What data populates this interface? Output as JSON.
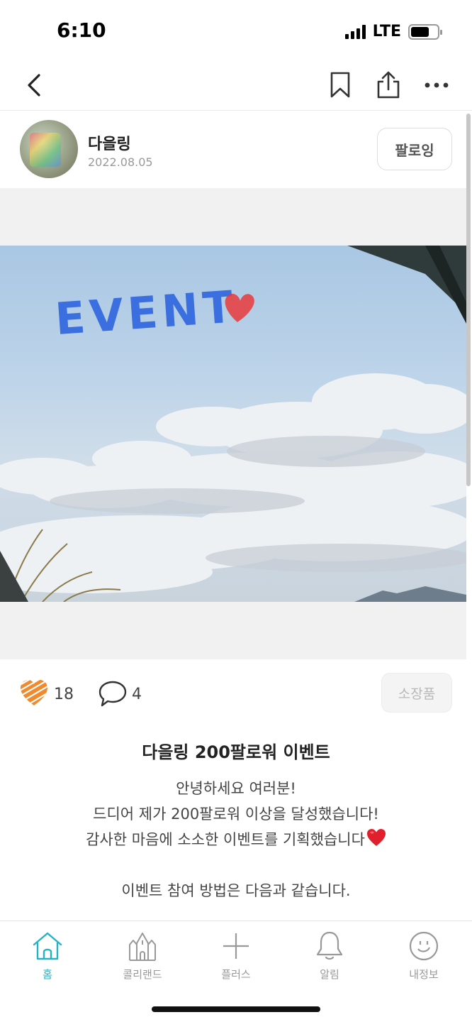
{
  "status_bar": {
    "time": "6:10",
    "network": "LTE",
    "battery_level": 0.7
  },
  "top_nav": {
    "icons": [
      "back-icon",
      "bookmark-icon",
      "share-icon",
      "more-icon"
    ]
  },
  "author": {
    "name": "다을링",
    "date": "2022.08.05",
    "follow_label": "팔로잉"
  },
  "photo": {
    "overlay_text": "EVENT",
    "overlay_color": "#3b6fe0",
    "heart_color": "#e83a3a"
  },
  "actions": {
    "like_count": "18",
    "comment_count": "4",
    "collect_label": "소장품",
    "like_color": "#f08a2c"
  },
  "post": {
    "title": "다을링 200팔로워 이벤트",
    "lines": [
      "안녕하세요 여러분!",
      "드디어 제가 200팔로워 이상을 달성했습니다!",
      "감사한 마음에 소소한 이벤트를 기획했습니다",
      "",
      "이벤트 참여 방법은 다음과 같습니다."
    ]
  },
  "tab_bar": {
    "accent": "#24b3c4",
    "tabs": [
      {
        "label": "홈",
        "icon": "home-icon",
        "active": true
      },
      {
        "label": "콜리랜드",
        "icon": "castle-icon",
        "active": false
      },
      {
        "label": "플러스",
        "icon": "plus-icon",
        "active": false
      },
      {
        "label": "알림",
        "icon": "bell-icon",
        "active": false
      },
      {
        "label": "내정보",
        "icon": "smiley-icon",
        "active": false
      }
    ]
  }
}
